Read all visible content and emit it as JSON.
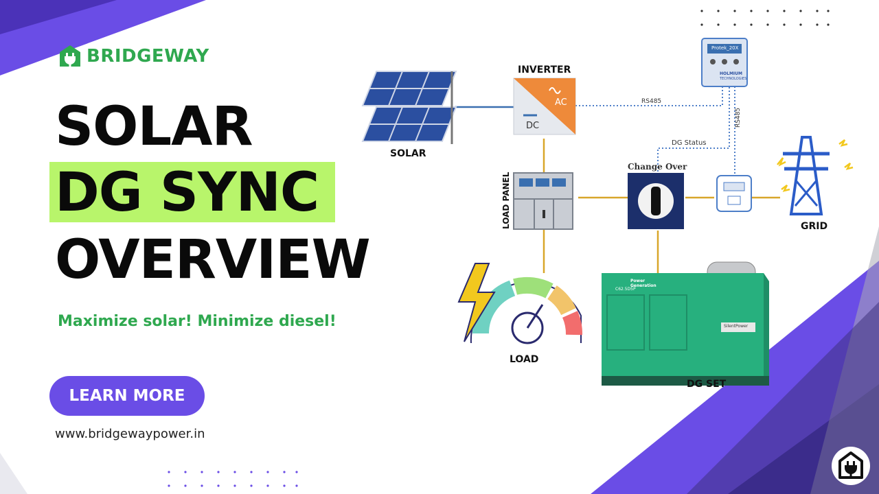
{
  "brand": {
    "name": "BRIDGEWAY",
    "icon": "plug-house-icon",
    "color": "#2fa84f"
  },
  "title": {
    "line1": "SOLAR",
    "line2": "DG SYNC",
    "line3": "OVERVIEW"
  },
  "highlight_color": "#b8f56b",
  "tagline": "Maximize solar! Minimize diesel!",
  "cta": {
    "label": "LEARN MORE",
    "color": "#6a4de6"
  },
  "website": "www.bridgewaypower.in",
  "diagram": {
    "nodes": {
      "solar": "SOLAR",
      "inverter": "INVERTER",
      "inverter_ac": "AC",
      "inverter_dc": "DC",
      "controller_screen": "Protek_20X",
      "controller_brand": "HOLMIUM",
      "controller_brand_sub": "TECHNOLOGIES",
      "load_panel": "LOAD PANEL",
      "changeover": "Change Over",
      "grid": "GRID",
      "load": "LOAD",
      "dg_set": "DG SET",
      "dg_brand_line1": "Power",
      "dg_brand_line2": "Generation",
      "dg_model": "C62.5D5P",
      "dg_badge": "SilentPower"
    },
    "links": {
      "rs485_inverter": "RS485",
      "rs485_meter": "RS485",
      "dg_status": "DG Status"
    },
    "colors": {
      "power_line": "#d8a62a",
      "dc_line": "#3a6fb0",
      "comm_line": "#4d7ec8",
      "inverter_orange": "#ee8a3a",
      "dg_green": "#27b07e"
    }
  },
  "corner_badge_icon": "plug-house-icon"
}
